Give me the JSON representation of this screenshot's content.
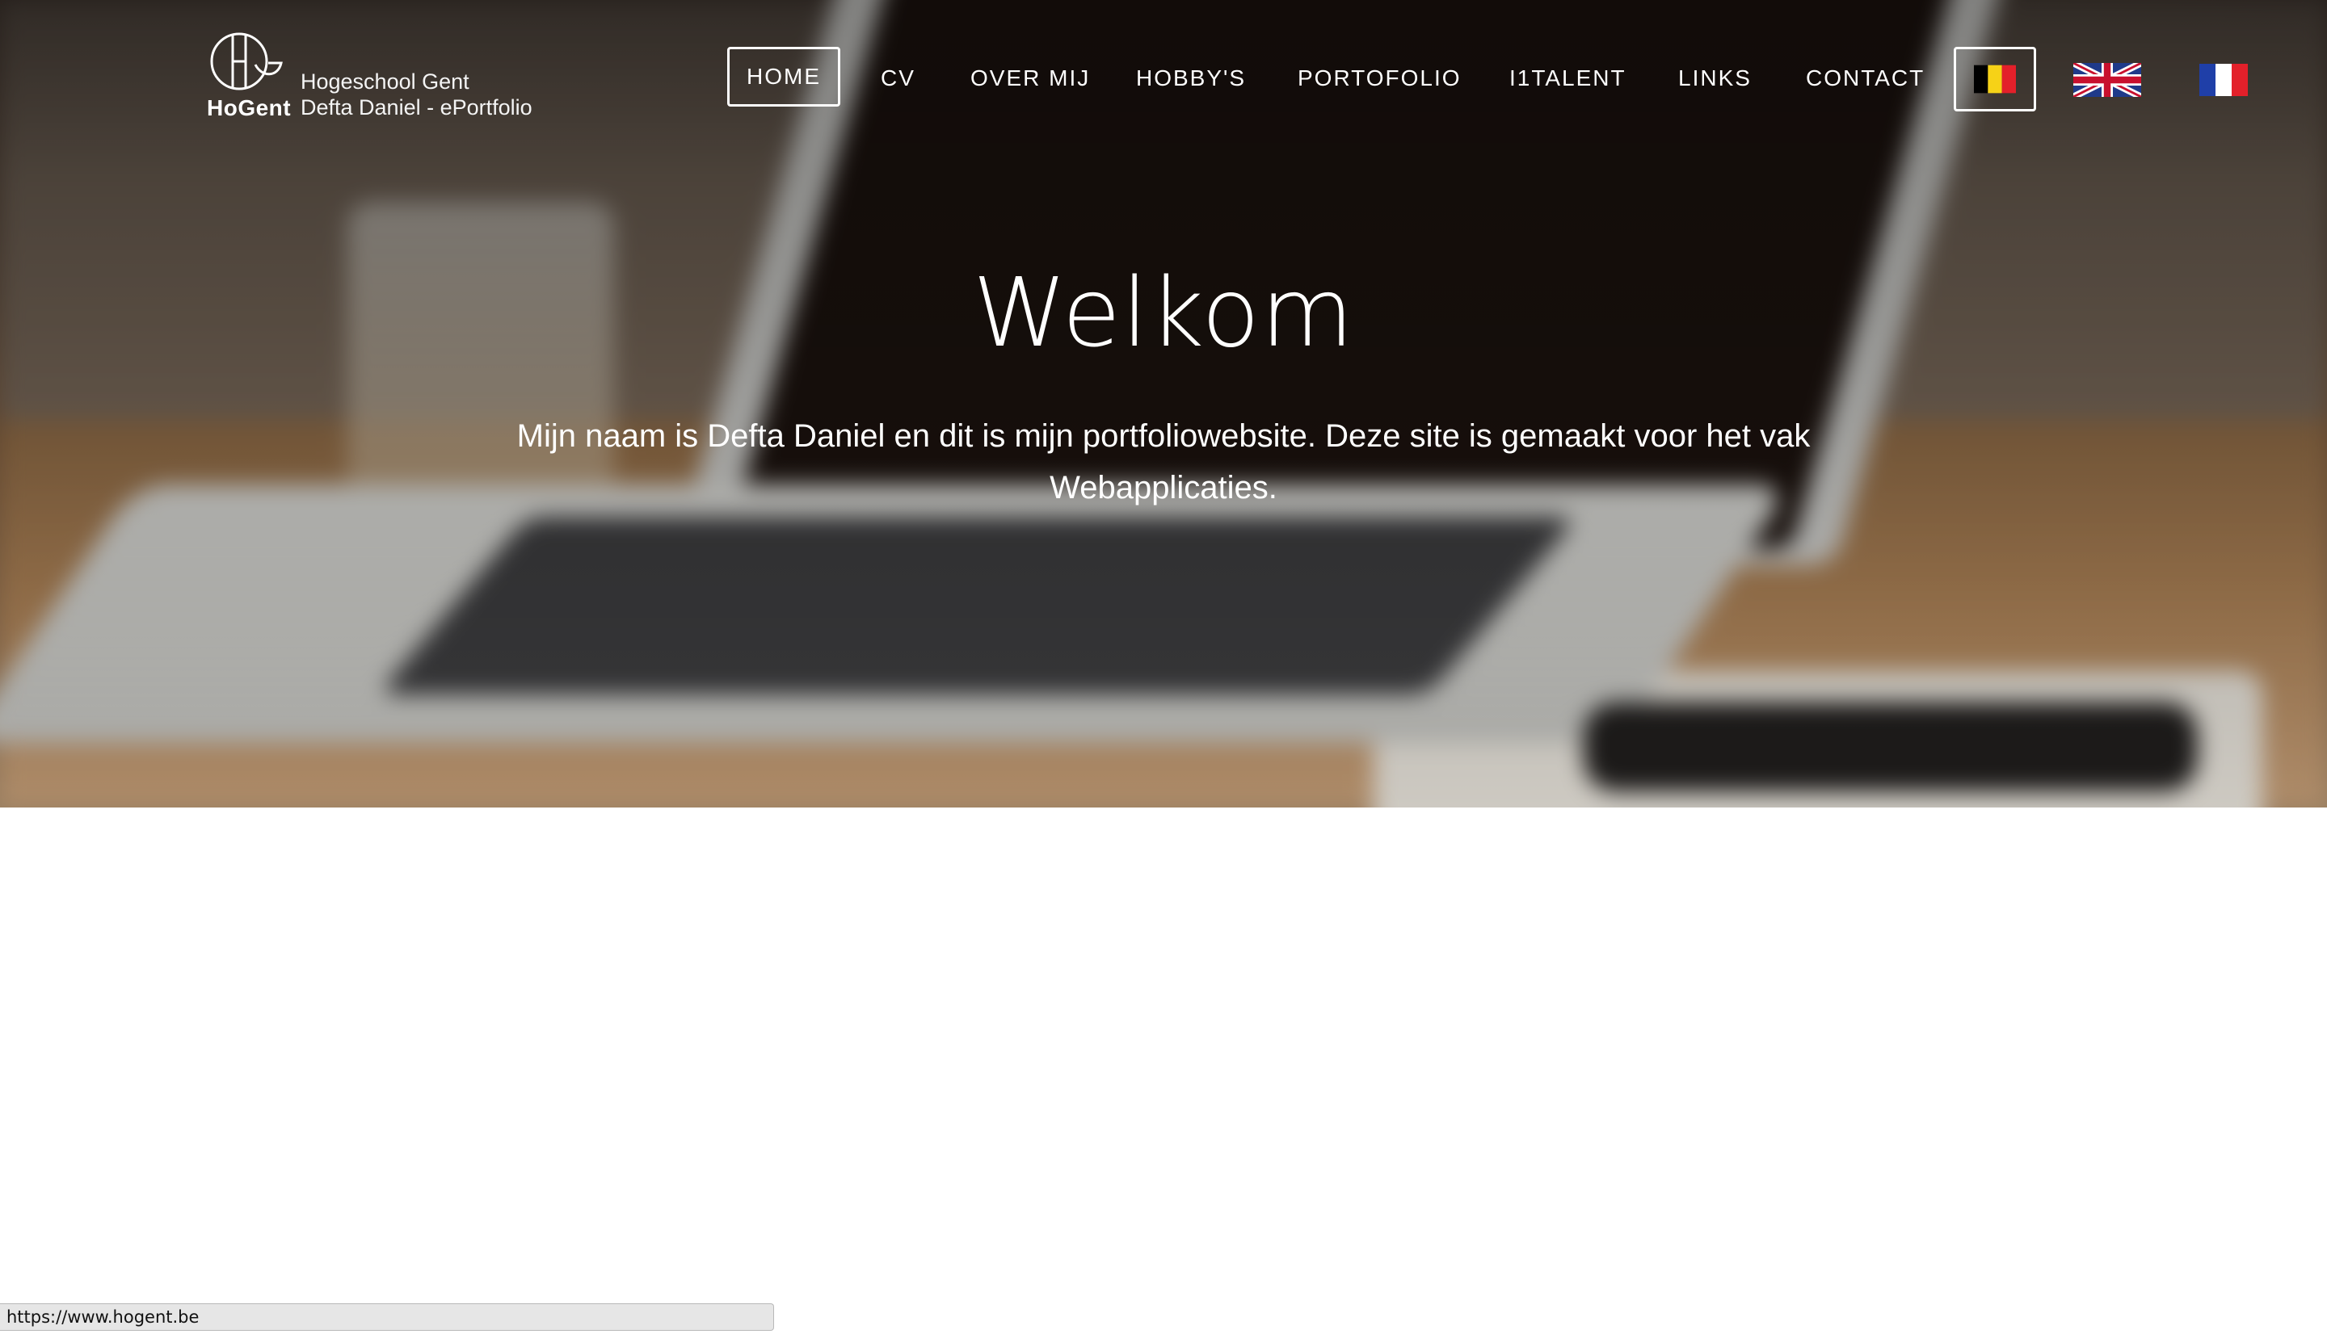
{
  "brand": {
    "logo_label": "HoGent",
    "line1": "Hogeschool Gent",
    "line2": "Defta Daniel - ePortfolio",
    "logo_icon": "hogent-logo-icon"
  },
  "nav": {
    "items": [
      {
        "label": "HOME",
        "active": true
      },
      {
        "label": "CV"
      },
      {
        "label": "OVER MIJ"
      },
      {
        "label": "HOBBY'S"
      },
      {
        "label": "PORTOFOLIO"
      },
      {
        "label": "I1TALENT"
      },
      {
        "label": "LINKS"
      },
      {
        "label": "CONTACT"
      }
    ],
    "languages": [
      {
        "code": "nl-BE",
        "icon": "belgium-flag-icon",
        "active": true
      },
      {
        "code": "en-GB",
        "icon": "uk-flag-icon"
      },
      {
        "code": "fr-FR",
        "icon": "france-flag-icon"
      }
    ]
  },
  "hero": {
    "title": "Welkom",
    "subtitle": "Mijn naam is Defta Daniel en dit is mijn portfoliowebsite. Deze site is gemaakt voor het vak Webapplicaties."
  },
  "status": {
    "url": "https://www.hogent.be"
  },
  "colors": {
    "text_on_hero": "#ffffff",
    "page_background": "#ffffff",
    "status_bar_bg": "#e6e6e6"
  }
}
